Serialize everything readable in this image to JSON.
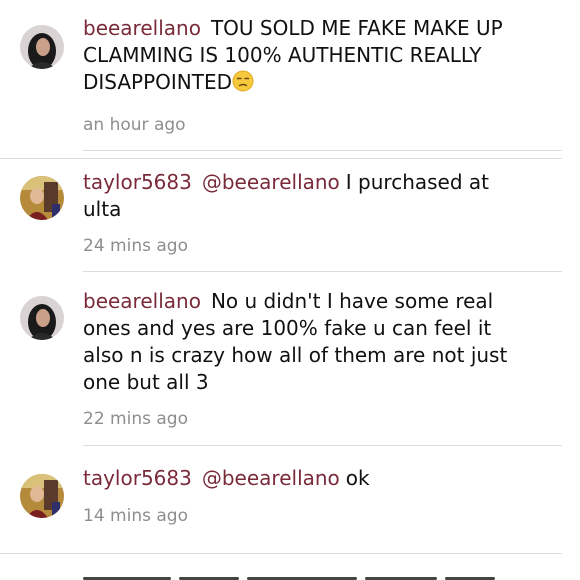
{
  "comments": [
    {
      "username": "beearellano",
      "mention": "",
      "text": "TOU SOLD ME FAKE MAKE UP CLAMMING IS 100% AUTHENTIC REALLY DISAPPOINTED",
      "emoji": "unamused-face",
      "time": "an hour ago"
    },
    {
      "username": "taylor5683",
      "mention": "@beearellano",
      "text": "I purchased at ulta",
      "time": "24 mins ago"
    },
    {
      "username": "beearellano",
      "mention": "",
      "text": "No u didn't I have some real ones and yes are 100% fake u can feel it also n is crazy how all of them are not just one but all 3",
      "time": "22 mins ago"
    },
    {
      "username": "taylor5683",
      "mention": "@beearellano",
      "text": "ok",
      "time": "14 mins ago"
    }
  ],
  "colors": {
    "username": "#7a2b39",
    "text": "#111111",
    "time": "#8e8e8e",
    "divider": "#dcdcdc"
  }
}
